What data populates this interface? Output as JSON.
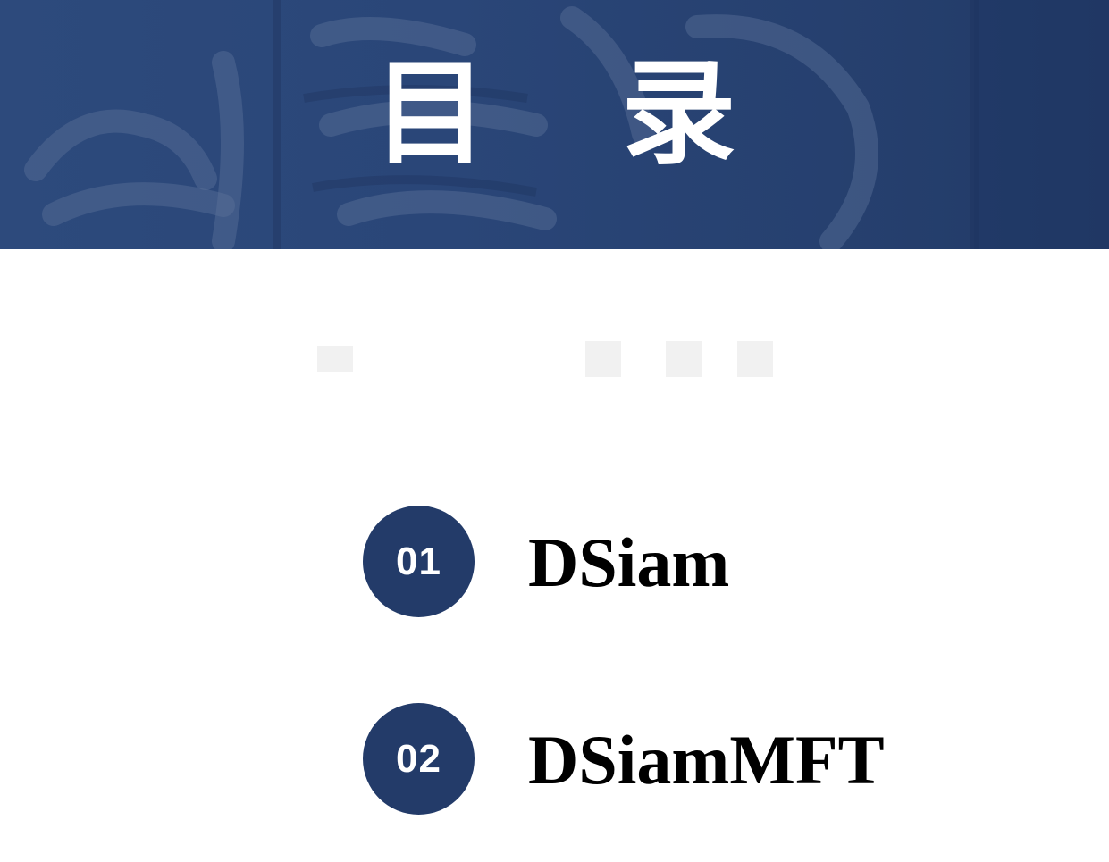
{
  "banner": {
    "title_char_1": "目",
    "title_char_2": "录",
    "background_color": "#2a4678"
  },
  "toc": {
    "items": [
      {
        "number": "01",
        "label": "DSiam"
      },
      {
        "number": "02",
        "label": "DSiamMFT"
      }
    ],
    "circle_color": "#233b69",
    "label_color": "#000000"
  }
}
